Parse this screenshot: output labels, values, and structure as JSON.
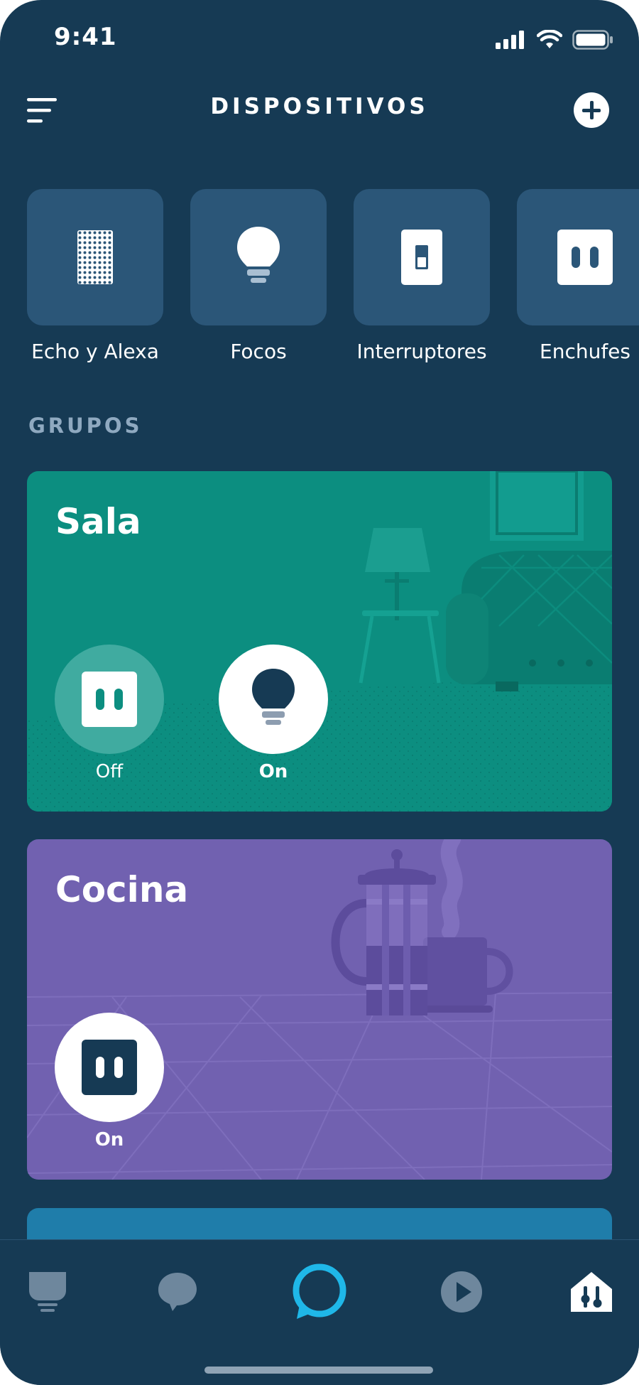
{
  "status_bar": {
    "time": "9:41"
  },
  "header": {
    "title": "DISPOSITIVOS"
  },
  "categories": [
    {
      "label": "Echo y Alexa",
      "icon": "speaker-icon"
    },
    {
      "label": "Focos",
      "icon": "bulb-icon"
    },
    {
      "label": "Interruptores",
      "icon": "switch-icon"
    },
    {
      "label": "Enchufes",
      "icon": "plug-icon"
    }
  ],
  "groups_heading": "GRUPOS",
  "groups": [
    {
      "name": "Sala",
      "devices": [
        {
          "type": "plug",
          "state": "Off"
        },
        {
          "type": "bulb",
          "state": "On"
        }
      ]
    },
    {
      "name": "Cocina",
      "devices": [
        {
          "type": "plug",
          "state": "On"
        }
      ]
    }
  ],
  "bottom_nav": [
    {
      "name": "home",
      "icon": "home-feed-icon",
      "active": false
    },
    {
      "name": "communicate",
      "icon": "chat-bubble-icon",
      "active": false
    },
    {
      "name": "alexa",
      "icon": "alexa-ring-icon",
      "active": false
    },
    {
      "name": "play",
      "icon": "play-icon",
      "active": false
    },
    {
      "name": "devices",
      "icon": "smart-home-icon",
      "active": true
    }
  ],
  "colors": {
    "background": "#163A54",
    "tile": "#2B5678",
    "sala": "#0C8E80",
    "cocina": "#7161B0",
    "third_group": "#1F7DAA",
    "alexa_accent": "#1FB7E8",
    "heading_muted": "#8FA9C0"
  }
}
